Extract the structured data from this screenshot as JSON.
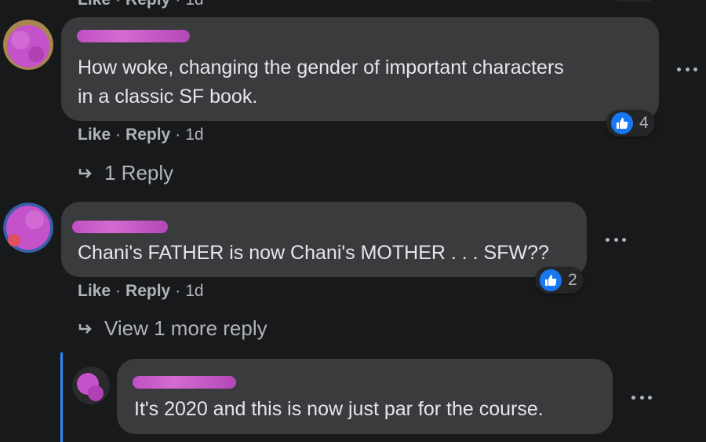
{
  "top_actions": {
    "like": "Like",
    "reply": "Reply",
    "time": "1d"
  },
  "comments": [
    {
      "text_line1": "How woke, changing the gender of important characters",
      "text_line2": "in a classic SF book.",
      "actions": {
        "like": "Like",
        "reply": "Reply",
        "time": "1d"
      },
      "reactions": {
        "icon": "thumbs-up-icon",
        "count": "4"
      },
      "replies_link": "1 Reply"
    },
    {
      "text": "Chani's FATHER is now Chani's MOTHER . . . SFW??",
      "actions": {
        "like": "Like",
        "reply": "Reply",
        "time": "1d"
      },
      "reactions": {
        "icon": "thumbs-up-icon",
        "count": "2"
      },
      "replies_link": "View 1 more reply"
    }
  ],
  "reply": {
    "text": "It's 2020 and this is now just par for the course."
  },
  "colors": {
    "background": "#18191a",
    "bubble": "#3a3b3c",
    "text": "#e4e6eb",
    "secondary_text": "#b0b3b8",
    "like_blue": "#1877f2",
    "thread_line": "#2d88ff",
    "redaction": "#c04fc4"
  }
}
